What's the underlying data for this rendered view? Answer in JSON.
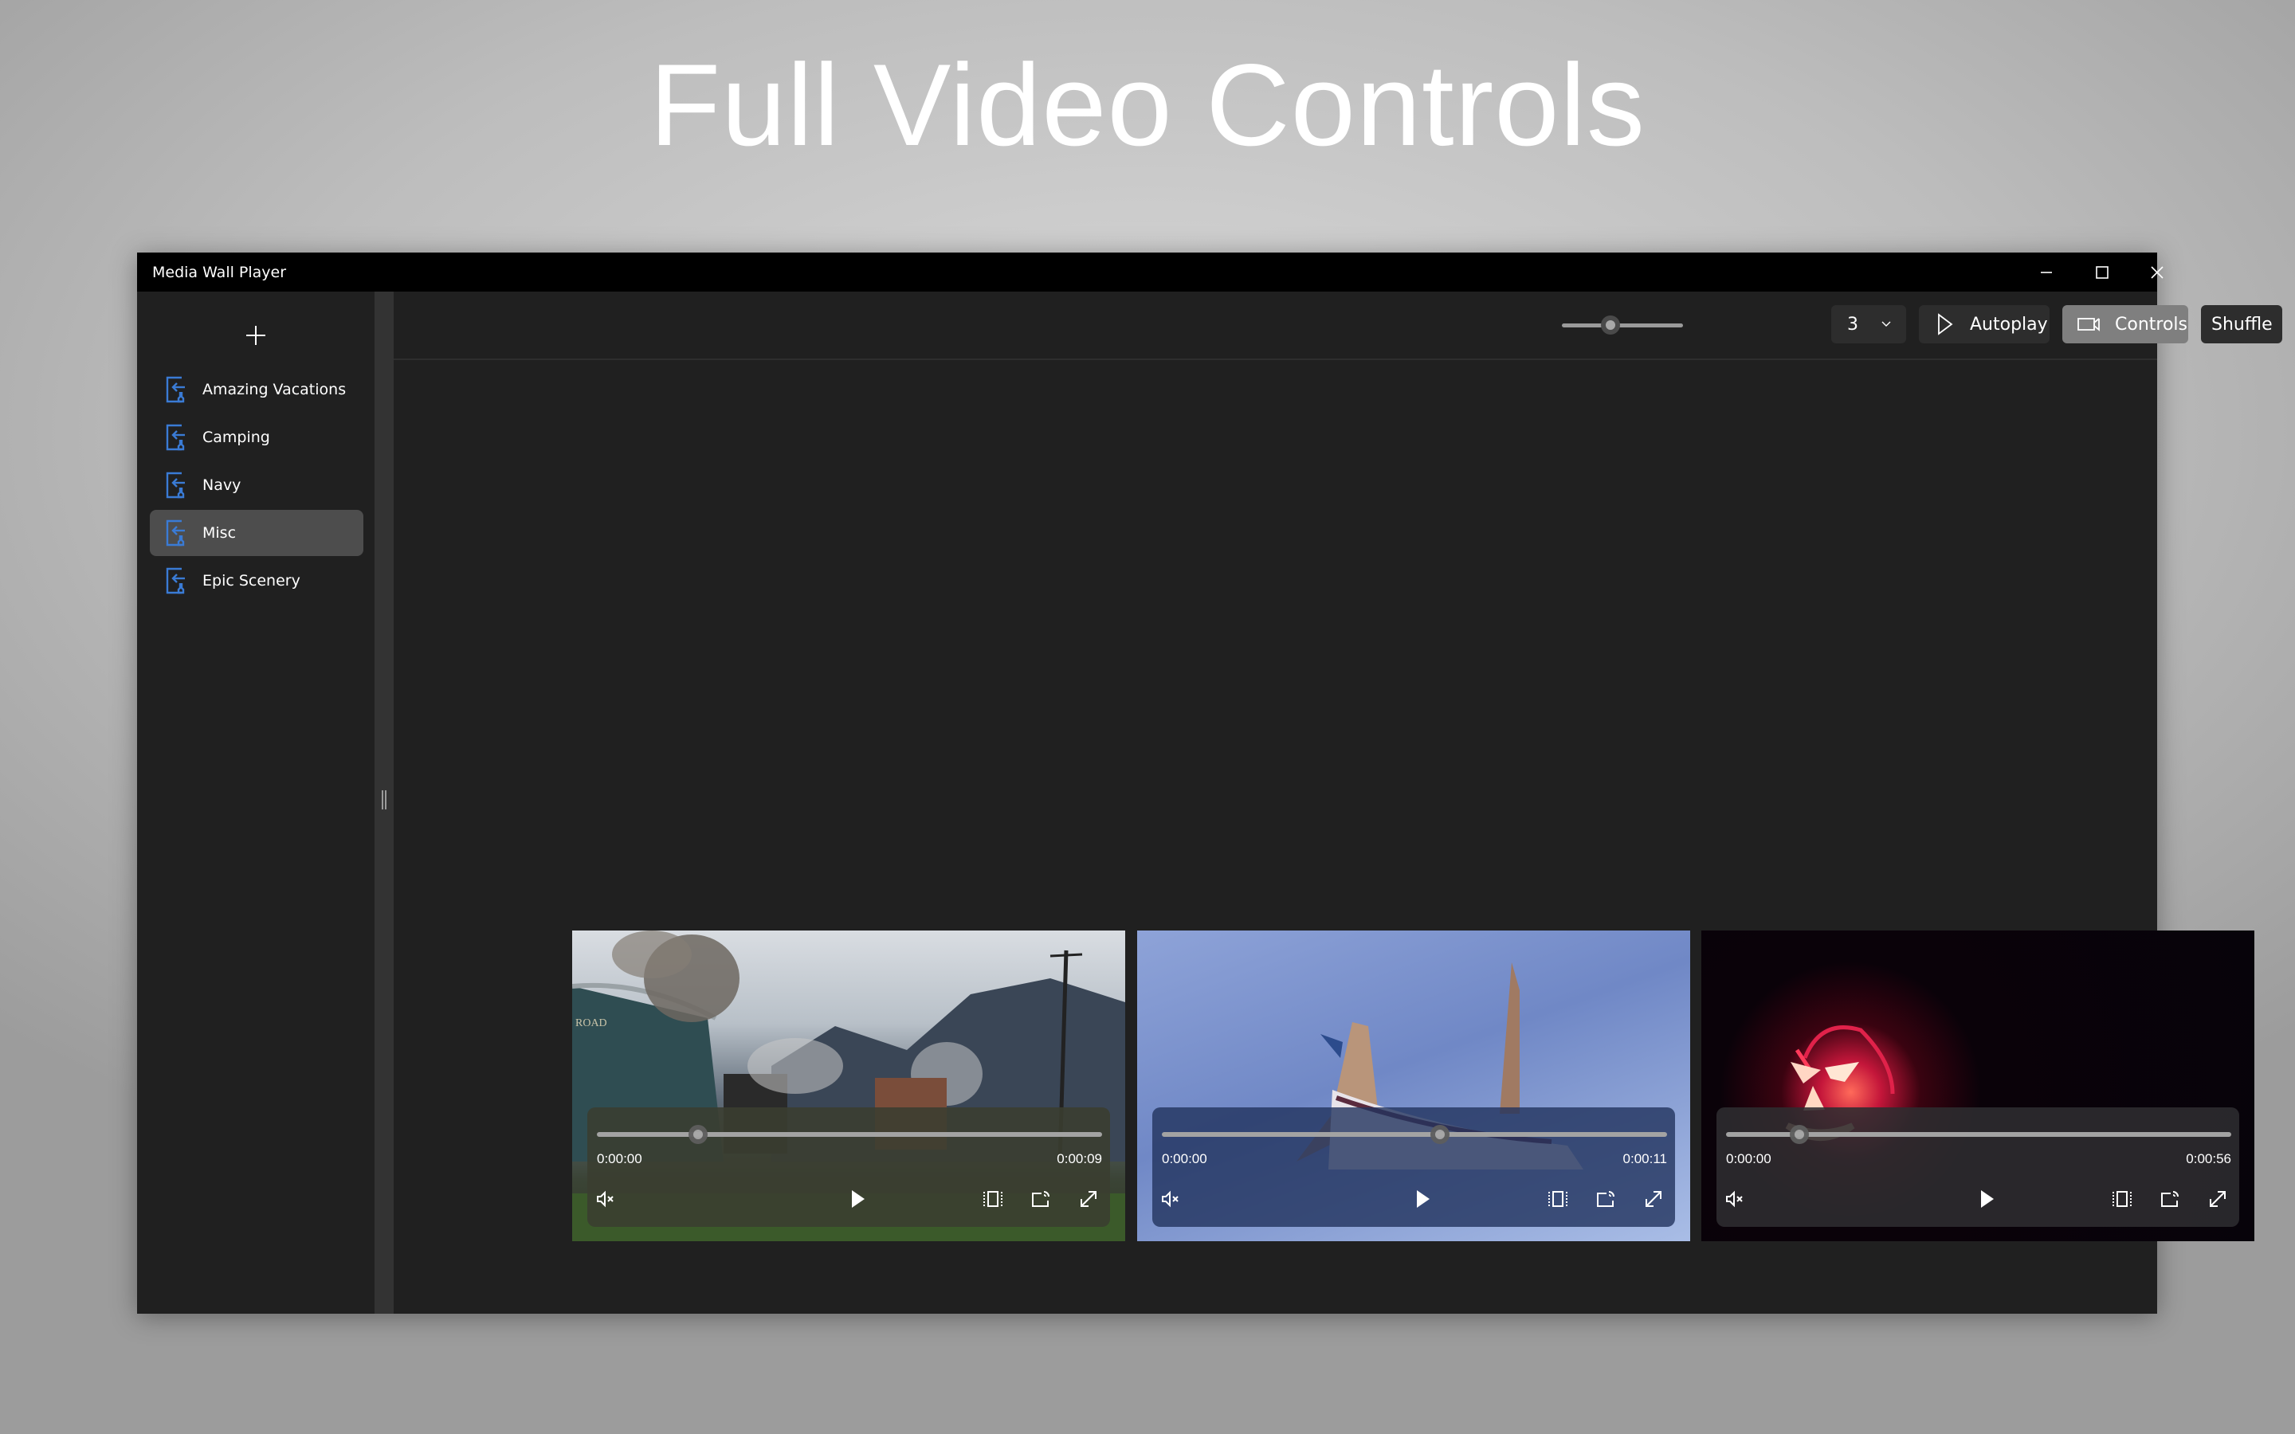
{
  "headline": "Full Video Controls",
  "window": {
    "title": "Media Wall Player",
    "controls": {
      "minimize": "minimize-icon",
      "maximize": "maximize-icon",
      "close": "close-icon"
    }
  },
  "sidebar": {
    "add_icon": "plus-icon",
    "items": [
      {
        "label": "Amazing Vacations",
        "icon": "folder-import-icon",
        "selected": false
      },
      {
        "label": "Camping",
        "icon": "folder-import-icon",
        "selected": false
      },
      {
        "label": "Navy",
        "icon": "folder-import-icon",
        "selected": false
      },
      {
        "label": "Misc",
        "icon": "folder-import-icon",
        "selected": true
      },
      {
        "label": "Epic Scenery",
        "icon": "folder-import-icon",
        "selected": false
      }
    ],
    "accent_color": "#3a7bd5"
  },
  "toolbar": {
    "tile_size_slider": {
      "value_fraction": 0.4
    },
    "columns_select": {
      "value": "3"
    },
    "autoplay_label": "Autoplay",
    "controls_label": "Controls",
    "controls_active": true,
    "shuffle_label": "Shuffle"
  },
  "videos": [
    {
      "scene": "steam train in mountains",
      "current_time": "0:00:00",
      "duration": "0:00:09",
      "seek_fraction": 0.2,
      "muted": true,
      "tint": "#3a3d30"
    },
    {
      "scene": "airplane against blue sky",
      "current_time": "0:00:00",
      "duration": "0:00:11",
      "seek_fraction": 0.55,
      "muted": true,
      "tint": "#22335e"
    },
    {
      "scene": "jack-o-lantern at night",
      "current_time": "0:00:00",
      "duration": "0:00:56",
      "seek_fraction": 0.145,
      "muted": true,
      "tint": "#2d2c30"
    }
  ]
}
